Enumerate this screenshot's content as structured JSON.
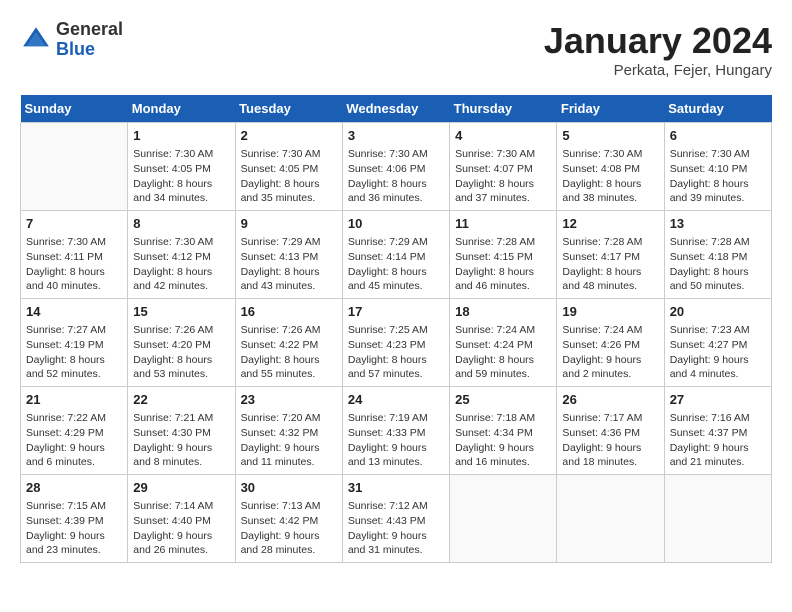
{
  "header": {
    "logo_general": "General",
    "logo_blue": "Blue",
    "month_title": "January 2024",
    "location": "Perkata, Fejer, Hungary"
  },
  "days": [
    "Sunday",
    "Monday",
    "Tuesday",
    "Wednesday",
    "Thursday",
    "Friday",
    "Saturday"
  ],
  "weeks": [
    [
      {
        "num": "",
        "sunrise": "",
        "sunset": "",
        "daylight": ""
      },
      {
        "num": "1",
        "sunrise": "Sunrise: 7:30 AM",
        "sunset": "Sunset: 4:05 PM",
        "daylight": "Daylight: 8 hours and 34 minutes."
      },
      {
        "num": "2",
        "sunrise": "Sunrise: 7:30 AM",
        "sunset": "Sunset: 4:05 PM",
        "daylight": "Daylight: 8 hours and 35 minutes."
      },
      {
        "num": "3",
        "sunrise": "Sunrise: 7:30 AM",
        "sunset": "Sunset: 4:06 PM",
        "daylight": "Daylight: 8 hours and 36 minutes."
      },
      {
        "num": "4",
        "sunrise": "Sunrise: 7:30 AM",
        "sunset": "Sunset: 4:07 PM",
        "daylight": "Daylight: 8 hours and 37 minutes."
      },
      {
        "num": "5",
        "sunrise": "Sunrise: 7:30 AM",
        "sunset": "Sunset: 4:08 PM",
        "daylight": "Daylight: 8 hours and 38 minutes."
      },
      {
        "num": "6",
        "sunrise": "Sunrise: 7:30 AM",
        "sunset": "Sunset: 4:10 PM",
        "daylight": "Daylight: 8 hours and 39 minutes."
      }
    ],
    [
      {
        "num": "7",
        "sunrise": "Sunrise: 7:30 AM",
        "sunset": "Sunset: 4:11 PM",
        "daylight": "Daylight: 8 hours and 40 minutes."
      },
      {
        "num": "8",
        "sunrise": "Sunrise: 7:30 AM",
        "sunset": "Sunset: 4:12 PM",
        "daylight": "Daylight: 8 hours and 42 minutes."
      },
      {
        "num": "9",
        "sunrise": "Sunrise: 7:29 AM",
        "sunset": "Sunset: 4:13 PM",
        "daylight": "Daylight: 8 hours and 43 minutes."
      },
      {
        "num": "10",
        "sunrise": "Sunrise: 7:29 AM",
        "sunset": "Sunset: 4:14 PM",
        "daylight": "Daylight: 8 hours and 45 minutes."
      },
      {
        "num": "11",
        "sunrise": "Sunrise: 7:28 AM",
        "sunset": "Sunset: 4:15 PM",
        "daylight": "Daylight: 8 hours and 46 minutes."
      },
      {
        "num": "12",
        "sunrise": "Sunrise: 7:28 AM",
        "sunset": "Sunset: 4:17 PM",
        "daylight": "Daylight: 8 hours and 48 minutes."
      },
      {
        "num": "13",
        "sunrise": "Sunrise: 7:28 AM",
        "sunset": "Sunset: 4:18 PM",
        "daylight": "Daylight: 8 hours and 50 minutes."
      }
    ],
    [
      {
        "num": "14",
        "sunrise": "Sunrise: 7:27 AM",
        "sunset": "Sunset: 4:19 PM",
        "daylight": "Daylight: 8 hours and 52 minutes."
      },
      {
        "num": "15",
        "sunrise": "Sunrise: 7:26 AM",
        "sunset": "Sunset: 4:20 PM",
        "daylight": "Daylight: 8 hours and 53 minutes."
      },
      {
        "num": "16",
        "sunrise": "Sunrise: 7:26 AM",
        "sunset": "Sunset: 4:22 PM",
        "daylight": "Daylight: 8 hours and 55 minutes."
      },
      {
        "num": "17",
        "sunrise": "Sunrise: 7:25 AM",
        "sunset": "Sunset: 4:23 PM",
        "daylight": "Daylight: 8 hours and 57 minutes."
      },
      {
        "num": "18",
        "sunrise": "Sunrise: 7:24 AM",
        "sunset": "Sunset: 4:24 PM",
        "daylight": "Daylight: 8 hours and 59 minutes."
      },
      {
        "num": "19",
        "sunrise": "Sunrise: 7:24 AM",
        "sunset": "Sunset: 4:26 PM",
        "daylight": "Daylight: 9 hours and 2 minutes."
      },
      {
        "num": "20",
        "sunrise": "Sunrise: 7:23 AM",
        "sunset": "Sunset: 4:27 PM",
        "daylight": "Daylight: 9 hours and 4 minutes."
      }
    ],
    [
      {
        "num": "21",
        "sunrise": "Sunrise: 7:22 AM",
        "sunset": "Sunset: 4:29 PM",
        "daylight": "Daylight: 9 hours and 6 minutes."
      },
      {
        "num": "22",
        "sunrise": "Sunrise: 7:21 AM",
        "sunset": "Sunset: 4:30 PM",
        "daylight": "Daylight: 9 hours and 8 minutes."
      },
      {
        "num": "23",
        "sunrise": "Sunrise: 7:20 AM",
        "sunset": "Sunset: 4:32 PM",
        "daylight": "Daylight: 9 hours and 11 minutes."
      },
      {
        "num": "24",
        "sunrise": "Sunrise: 7:19 AM",
        "sunset": "Sunset: 4:33 PM",
        "daylight": "Daylight: 9 hours and 13 minutes."
      },
      {
        "num": "25",
        "sunrise": "Sunrise: 7:18 AM",
        "sunset": "Sunset: 4:34 PM",
        "daylight": "Daylight: 9 hours and 16 minutes."
      },
      {
        "num": "26",
        "sunrise": "Sunrise: 7:17 AM",
        "sunset": "Sunset: 4:36 PM",
        "daylight": "Daylight: 9 hours and 18 minutes."
      },
      {
        "num": "27",
        "sunrise": "Sunrise: 7:16 AM",
        "sunset": "Sunset: 4:37 PM",
        "daylight": "Daylight: 9 hours and 21 minutes."
      }
    ],
    [
      {
        "num": "28",
        "sunrise": "Sunrise: 7:15 AM",
        "sunset": "Sunset: 4:39 PM",
        "daylight": "Daylight: 9 hours and 23 minutes."
      },
      {
        "num": "29",
        "sunrise": "Sunrise: 7:14 AM",
        "sunset": "Sunset: 4:40 PM",
        "daylight": "Daylight: 9 hours and 26 minutes."
      },
      {
        "num": "30",
        "sunrise": "Sunrise: 7:13 AM",
        "sunset": "Sunset: 4:42 PM",
        "daylight": "Daylight: 9 hours and 28 minutes."
      },
      {
        "num": "31",
        "sunrise": "Sunrise: 7:12 AM",
        "sunset": "Sunset: 4:43 PM",
        "daylight": "Daylight: 9 hours and 31 minutes."
      },
      {
        "num": "",
        "sunrise": "",
        "sunset": "",
        "daylight": ""
      },
      {
        "num": "",
        "sunrise": "",
        "sunset": "",
        "daylight": ""
      },
      {
        "num": "",
        "sunrise": "",
        "sunset": "",
        "daylight": ""
      }
    ]
  ]
}
